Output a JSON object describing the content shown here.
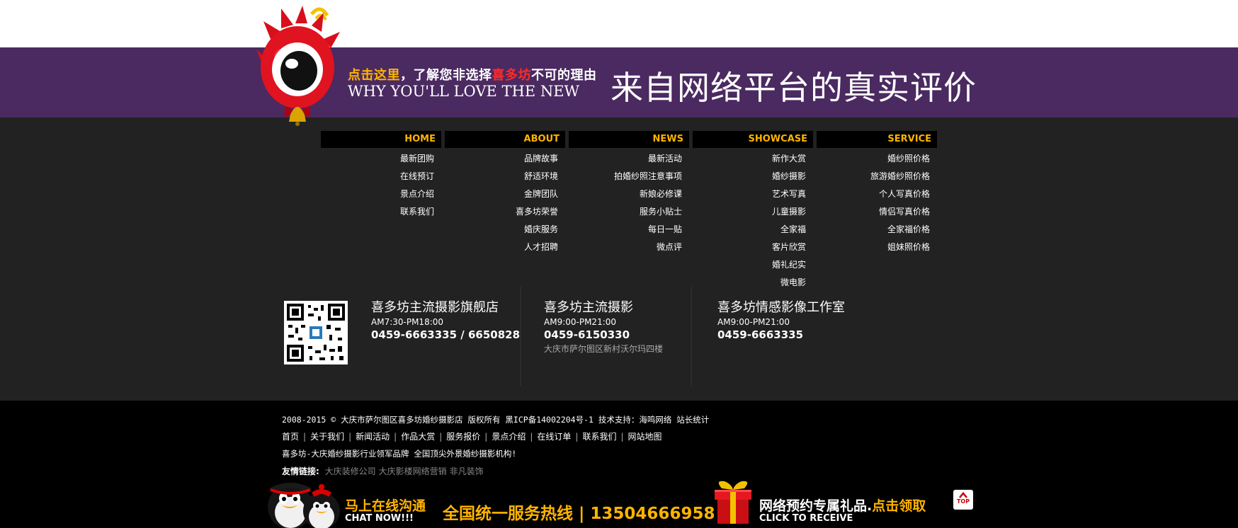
{
  "banner": {
    "promo_part1": "点击这里",
    "promo_part2": "，了解您非选择",
    "promo_brand": "喜多坊",
    "promo_part3": "不可的理由",
    "promo_en": "WHY YOU'LL LOVE THE NEW",
    "promo_big": "来自网络平台的真实评价"
  },
  "nav": {
    "columns": [
      {
        "title": "HOME",
        "items": [
          "最新团购",
          "在线预订",
          "景点介绍",
          "联系我们"
        ]
      },
      {
        "title": "ABOUT",
        "items": [
          "品牌故事",
          "舒适环境",
          "金牌团队",
          "喜多坊荣誉",
          "婚庆服务",
          "人才招聘"
        ]
      },
      {
        "title": "NEWS",
        "items": [
          "最新活动",
          "拍婚纱照注意事项",
          "新娘必修课",
          "服务小贴士",
          "每日一贴",
          "微点评"
        ]
      },
      {
        "title": "SHOWCASE",
        "items": [
          "新作大赏",
          "婚纱摄影",
          "艺术写真",
          "儿童摄影",
          "全家福",
          "客片欣赏",
          "婚礼纪实",
          "微电影"
        ]
      },
      {
        "title": "SERVICE",
        "items": [
          "婚纱照价格",
          "旅游婚纱照价格",
          "个人写真价格",
          "情侣写真价格",
          "全家福价格",
          "姐妹照价格"
        ]
      }
    ]
  },
  "stores": [
    {
      "name": "喜多坊主流摄影旗舰店",
      "hours": "AM7:30-PM18:00",
      "phone": "0459-6663335 / 6650828",
      "address": ""
    },
    {
      "name": "喜多坊主流摄影",
      "hours": "AM9:00-PM21:00",
      "phone": "0459-6150330",
      "address": "大庆市萨尔图区新村沃尔玛四楼"
    },
    {
      "name": "喜多坊情感影像工作室",
      "hours": "AM9:00-PM21:00",
      "phone": "0459-6663335",
      "address": ""
    }
  ],
  "footer": {
    "copyright": "2008-2015 © 大庆市萨尔图区喜多坊婚纱摄影店 版权所有 黑ICP备14002204号-1 技术支持：海鸣网络 站长统计",
    "nav_links": [
      "首页",
      "关于我们",
      "新闻活动",
      "作品大赏",
      "服务报价",
      "景点介绍",
      "在线订单",
      "联系我们",
      "网站地图"
    ],
    "slogan": "喜多坊-大庆婚纱摄影行业领军品牌 全国顶尖外景婚纱摄影机构!",
    "friend_links_label": "友情链接:",
    "friend_links": [
      "大庆装修公司",
      "大庆影楼网络营销",
      "非凡装饰"
    ]
  },
  "bottom_bar": {
    "chat_cn": "马上在线沟通",
    "chat_en": "CHAT NOW!!!",
    "hotline": "全国统一服务热线 | 13504666958",
    "gift_cn_part1": "网络预约专属礼品.",
    "gift_cn_part2": "点击领取",
    "gift_en": "CLICK TO RECEIVE",
    "top_label": "TOP"
  },
  "colors": {
    "banner_purple": "#4a2a60",
    "accent_yellow": "#ffb400",
    "accent_red": "#ff2a2a",
    "page_bg": "#222222",
    "footer_bg": "#000000"
  }
}
